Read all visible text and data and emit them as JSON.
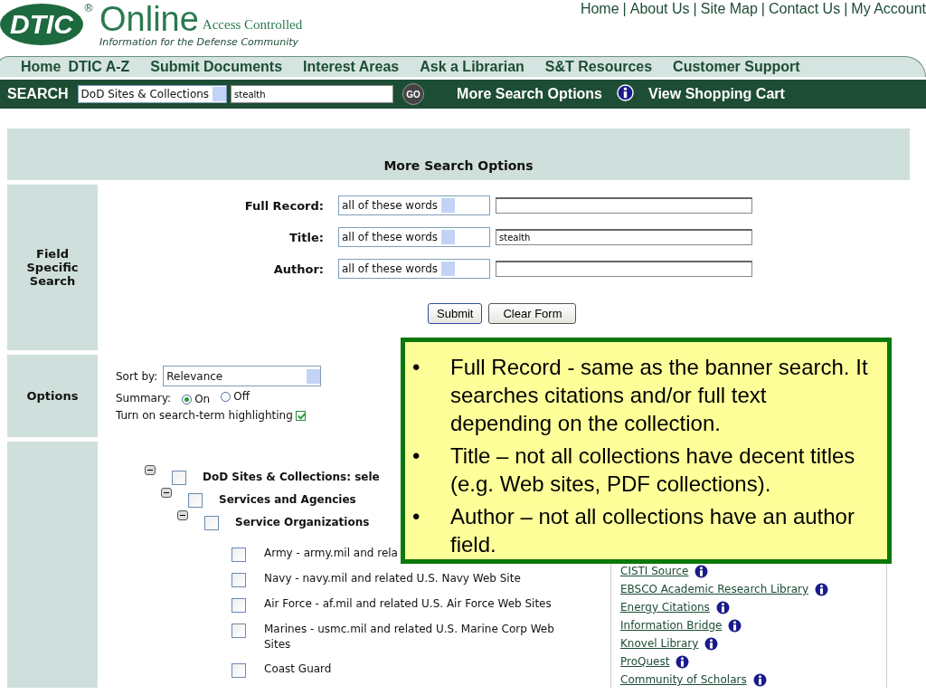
{
  "logo": {
    "mark": "DTIC",
    "registered": "®",
    "name": "Online",
    "badge": "Access Controlled",
    "tagline": "Information for the Defense Community"
  },
  "top_links": {
    "separator": "|",
    "items": [
      "Home",
      "About Us",
      "Site Map",
      "Contact Us",
      "My Account"
    ]
  },
  "nav": [
    "Home",
    "DTIC A-Z",
    "Submit Documents",
    "Interest Areas",
    "Ask a Librarian",
    "S&T Resources",
    "Customer Support"
  ],
  "search_bar": {
    "label": "SEARCH",
    "scope": "DoD Sites & Collections",
    "query": "stealth",
    "go": "GO",
    "more": "More Search Options",
    "cart": "View Shopping Cart"
  },
  "panel": {
    "title": "More Search Options",
    "field_search": {
      "heading": "Field Specific Search",
      "fields": [
        {
          "label": "Full Record:",
          "mode": "all of these words"
        },
        {
          "label": "Title:",
          "mode": "all of these words",
          "value": "stealth"
        },
        {
          "label": "Author:",
          "mode": "all of these words"
        }
      ],
      "buttons": [
        "Submit",
        "Clear Form"
      ]
    },
    "options": {
      "heading": "Options",
      "sort_label": "Sort by:",
      "sort_value": "Relevance",
      "summary_label": "Summary:",
      "summary": [
        {
          "label": "On",
          "selected": true
        },
        {
          "label": "Off",
          "selected": false
        }
      ],
      "highlight": {
        "label": "Turn on search-term highlighting",
        "checked": true
      }
    },
    "collections": {
      "tree": [
        {
          "label": "DoD Sites & Collections: sele",
          "expanded": true,
          "checked": false,
          "children": [
            {
              "label": "Services and Agencies",
              "expanded": true,
              "checked": false,
              "children": [
                {
                  "label": "Service Organizations",
                  "expanded": true,
                  "checked": false,
                  "children": [
                    {
                      "label": "Army - army.mil and rela",
                      "checked": false
                    },
                    {
                      "label": "Navy - navy.mil and related U.S. Navy Web Site",
                      "checked": false
                    },
                    {
                      "label": "Air Force - af.mil and related U.S. Air Force Web Sites",
                      "checked": false
                    },
                    {
                      "label": "Marines - usmc.mil and related U.S. Marine Corp Web Sites",
                      "checked": false
                    },
                    {
                      "label": "Coast Guard",
                      "checked": false
                    }
                  ]
                }
              ]
            }
          ]
        }
      ],
      "resources": [
        "CISTI Source",
        "EBSCO Academic Research Library",
        "Energy Citations",
        "Information Bridge",
        "Knovel Library",
        "ProQuest",
        "Community of Scholars"
      ]
    }
  },
  "callout": {
    "bullet": "•",
    "points": [
      "Full Record - same as the banner search. It searches citations and/or full text depending on the collection.",
      "Title – not all collections have decent titles (e.g. Web sites, PDF collections).",
      "Author – not all collections have an author field."
    ]
  }
}
